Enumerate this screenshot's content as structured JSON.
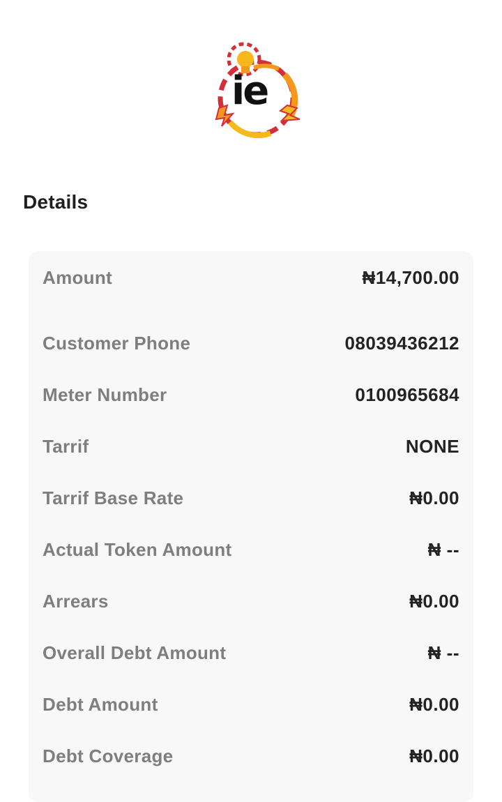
{
  "brand": {
    "logo_text": "ie",
    "colors": {
      "red": "#d32f3a",
      "orange": "#f39a1e",
      "yellow": "#f6b81b"
    }
  },
  "section": {
    "title": "Details"
  },
  "details": [
    {
      "label": "Amount",
      "value": "₦14,700.00"
    },
    {
      "label": "Customer Phone",
      "value": "08039436212"
    },
    {
      "label": "Meter Number",
      "value": "0100965684"
    },
    {
      "label": "Tarrif",
      "value": "NONE"
    },
    {
      "label": "Tarrif Base Rate",
      "value": "₦0.00"
    },
    {
      "label": "Actual Token Amount",
      "value": "₦ --"
    },
    {
      "label": "Arrears",
      "value": "₦0.00"
    },
    {
      "label": "Overall Debt Amount",
      "value": "₦ --"
    },
    {
      "label": "Debt Amount",
      "value": "₦0.00"
    },
    {
      "label": "Debt Coverage",
      "value": "₦0.00"
    }
  ]
}
